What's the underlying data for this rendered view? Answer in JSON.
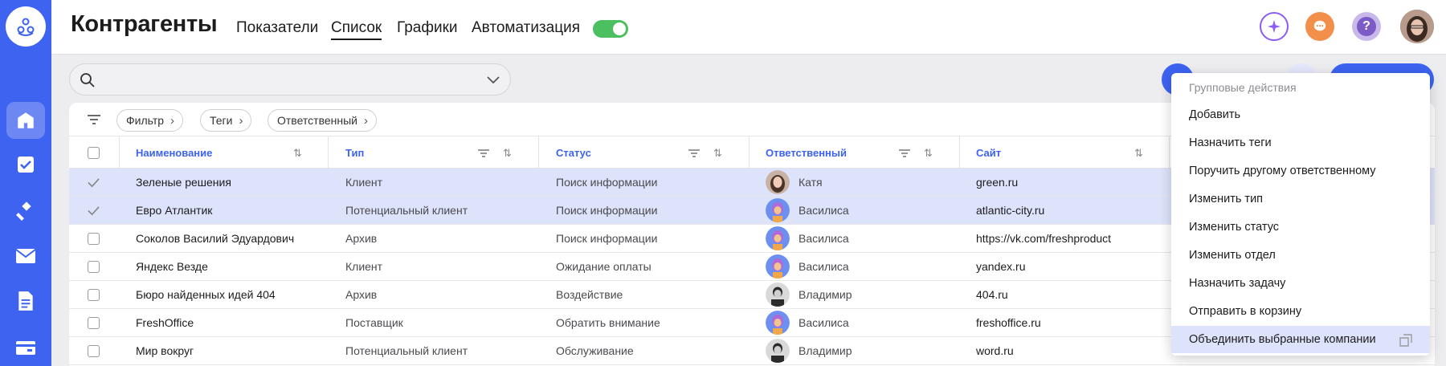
{
  "header": {
    "title": "Контрагенты",
    "tabs": [
      "Показатели",
      "Список",
      "Графики",
      "Автоматизация"
    ],
    "active_tab": "Список",
    "toggle_on": true
  },
  "search": {
    "placeholder": ""
  },
  "filters": [
    "Фильтр",
    "Теги",
    "Ответственный"
  ],
  "table": {
    "columns": [
      "Наименование",
      "Тип",
      "Статус",
      "Ответственный",
      "Сайт"
    ],
    "rows": [
      {
        "name": "Зеленые решения",
        "type": "Клиент",
        "status": "Поиск информации",
        "owner": "Катя",
        "site": "green.ru",
        "selected": true
      },
      {
        "name": "Евро Атлантик",
        "type": "Потенциальный клиент",
        "status": "Поиск информации",
        "owner": "Василиса",
        "site": "atlantic-city.ru",
        "selected": true
      },
      {
        "name": "Соколов Василий Эдуардович",
        "type": "Архив",
        "status": "Поиск информации",
        "owner": "Василиса",
        "site": "https://vk.com/freshproduct",
        "selected": false
      },
      {
        "name": "Яндекс Везде",
        "type": "Клиент",
        "status": "Ожидание оплаты",
        "owner": "Василиса",
        "site": "yandex.ru",
        "selected": false
      },
      {
        "name": "Бюро найденных идей 404",
        "type": "Архив",
        "status": "Воздействие",
        "owner": "Владимир",
        "site": "404.ru",
        "selected": false
      },
      {
        "name": "FreshOffice",
        "type": "Поставщик",
        "status": "Обратить внимание",
        "owner": "Василиса",
        "site": "freshoffice.ru",
        "selected": false
      },
      {
        "name": "Мир вокруг",
        "type": "Потенциальный клиент",
        "status": "Обслуживание",
        "owner": "Владимир",
        "site": "word.ru",
        "selected": false
      }
    ]
  },
  "menu": {
    "header": "Групповые действия",
    "items": [
      "Добавить",
      "Назначить теги",
      "Поручить другому ответственному",
      "Изменить тип",
      "Изменить статус",
      "Изменить отдел",
      "Назначить задачу",
      "Отправить в корзину",
      "Объединить выбранные компании"
    ],
    "highlighted": "Объединить выбранные компании"
  },
  "colors": {
    "accent": "#3d63f0",
    "selected_row": "#dde3fb",
    "toggle": "#4cbf60"
  }
}
